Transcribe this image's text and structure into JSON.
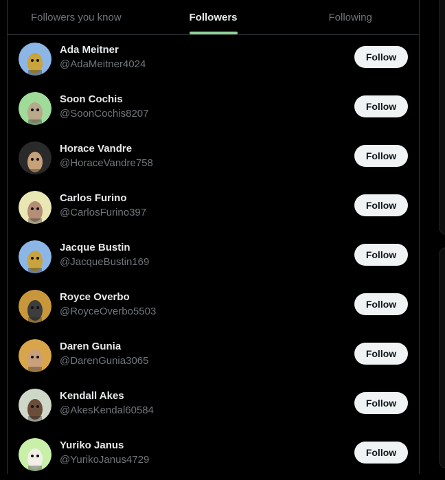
{
  "tabs": [
    {
      "label": "Followers you know"
    },
    {
      "label": "Followers"
    },
    {
      "label": "Following"
    }
  ],
  "follow_label": "Follow",
  "users": [
    {
      "name": "Ada Meitner",
      "handle": "@AdaMeitner4024",
      "avatar_bg": "#8bb6e6",
      "avatar_fg": "#c9a33b"
    },
    {
      "name": "Soon Cochis",
      "handle": "@SoonCochis8207",
      "avatar_bg": "#9fdc9a",
      "avatar_fg": "#b7a98a"
    },
    {
      "name": "Horace Vandre",
      "handle": "@HoraceVandre758",
      "avatar_bg": "#2a2a2a",
      "avatar_fg": "#c7a17a"
    },
    {
      "name": "Carlos Furino",
      "handle": "@CarlosFurino397",
      "avatar_bg": "#e9e7b3",
      "avatar_fg": "#b58e78"
    },
    {
      "name": "Jacque Bustin",
      "handle": "@JacqueBustin169",
      "avatar_bg": "#8bb6e6",
      "avatar_fg": "#c9a33b"
    },
    {
      "name": "Royce Overbo",
      "handle": "@RoyceOverbo5503",
      "avatar_bg": "#c8973b",
      "avatar_fg": "#3d3d3d"
    },
    {
      "name": "Daren Gunia",
      "handle": "@DarenGunia3065",
      "avatar_bg": "#d9a54a",
      "avatar_fg": "#c9a07a"
    },
    {
      "name": "Kendall Akes",
      "handle": "@AkesKendal60584",
      "avatar_bg": "#cfd8c8",
      "avatar_fg": "#6b4e3a"
    },
    {
      "name": "Yuriko Janus",
      "handle": "@YurikoJanus4729",
      "avatar_bg": "#c8f0a8",
      "avatar_fg": "#f1efe6"
    }
  ]
}
